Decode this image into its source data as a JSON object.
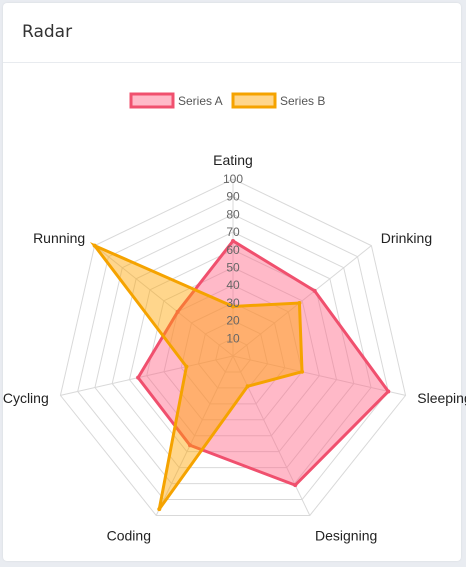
{
  "card": {
    "title": "Radar"
  },
  "chart_data": {
    "type": "radar",
    "title": "Radar",
    "categories": [
      "Eating",
      "Drinking",
      "Sleeping",
      "Designing",
      "Coding",
      "Cycling",
      "Running"
    ],
    "series": [
      {
        "name": "Series A",
        "values": [
          65,
          59,
          90,
          81,
          56,
          55,
          40
        ],
        "stroke": "#f0506e",
        "fill": "rgba(255,99,132,0.45)"
      },
      {
        "name": "Series B",
        "values": [
          28,
          48,
          40,
          19,
          96,
          27,
          100
        ],
        "stroke": "#f5a300",
        "fill": "rgba(255,165,0,0.45)"
      }
    ],
    "ticks": [
      10,
      20,
      30,
      40,
      50,
      60,
      70,
      80,
      90,
      100
    ],
    "range": [
      0,
      100
    ],
    "grid": true,
    "legend_position": "top"
  }
}
